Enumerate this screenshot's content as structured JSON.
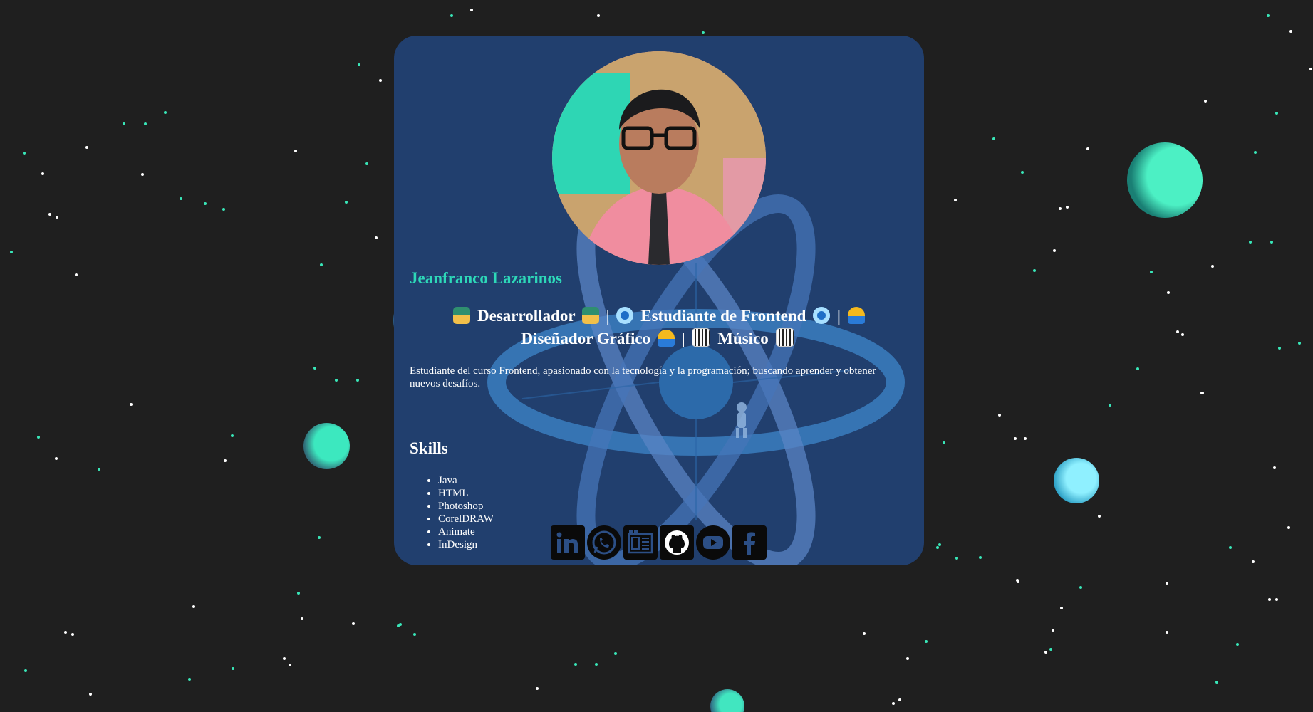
{
  "profile": {
    "name": "Jeanfranco Lazarinos",
    "tagline": {
      "role_developer": "Desarrollador",
      "role_frontend": "Estudiante de Frontend",
      "role_designer": "Diseñador Gráfico",
      "role_musician": "Músico",
      "separator": "|"
    },
    "description": "Estudiante del curso Frontend, apasionado con la tecnología y la programación; buscando aprender y obtener nuevos desafíos."
  },
  "skills": {
    "title": "Skills",
    "items": [
      "Java",
      "HTML",
      "Photoshop",
      "CorelDRAW",
      "Animate",
      "InDesign"
    ]
  },
  "socials": [
    {
      "icon": "linkedin-icon"
    },
    {
      "icon": "whatsapp-icon"
    },
    {
      "icon": "portfolio-icon"
    },
    {
      "icon": "github-icon"
    },
    {
      "icon": "youtube-icon"
    },
    {
      "icon": "facebook-icon"
    }
  ],
  "colors": {
    "background": "#1f1f1f",
    "card": "#213f6e",
    "accent": "#2dd8b8",
    "text": "#ffffff"
  }
}
